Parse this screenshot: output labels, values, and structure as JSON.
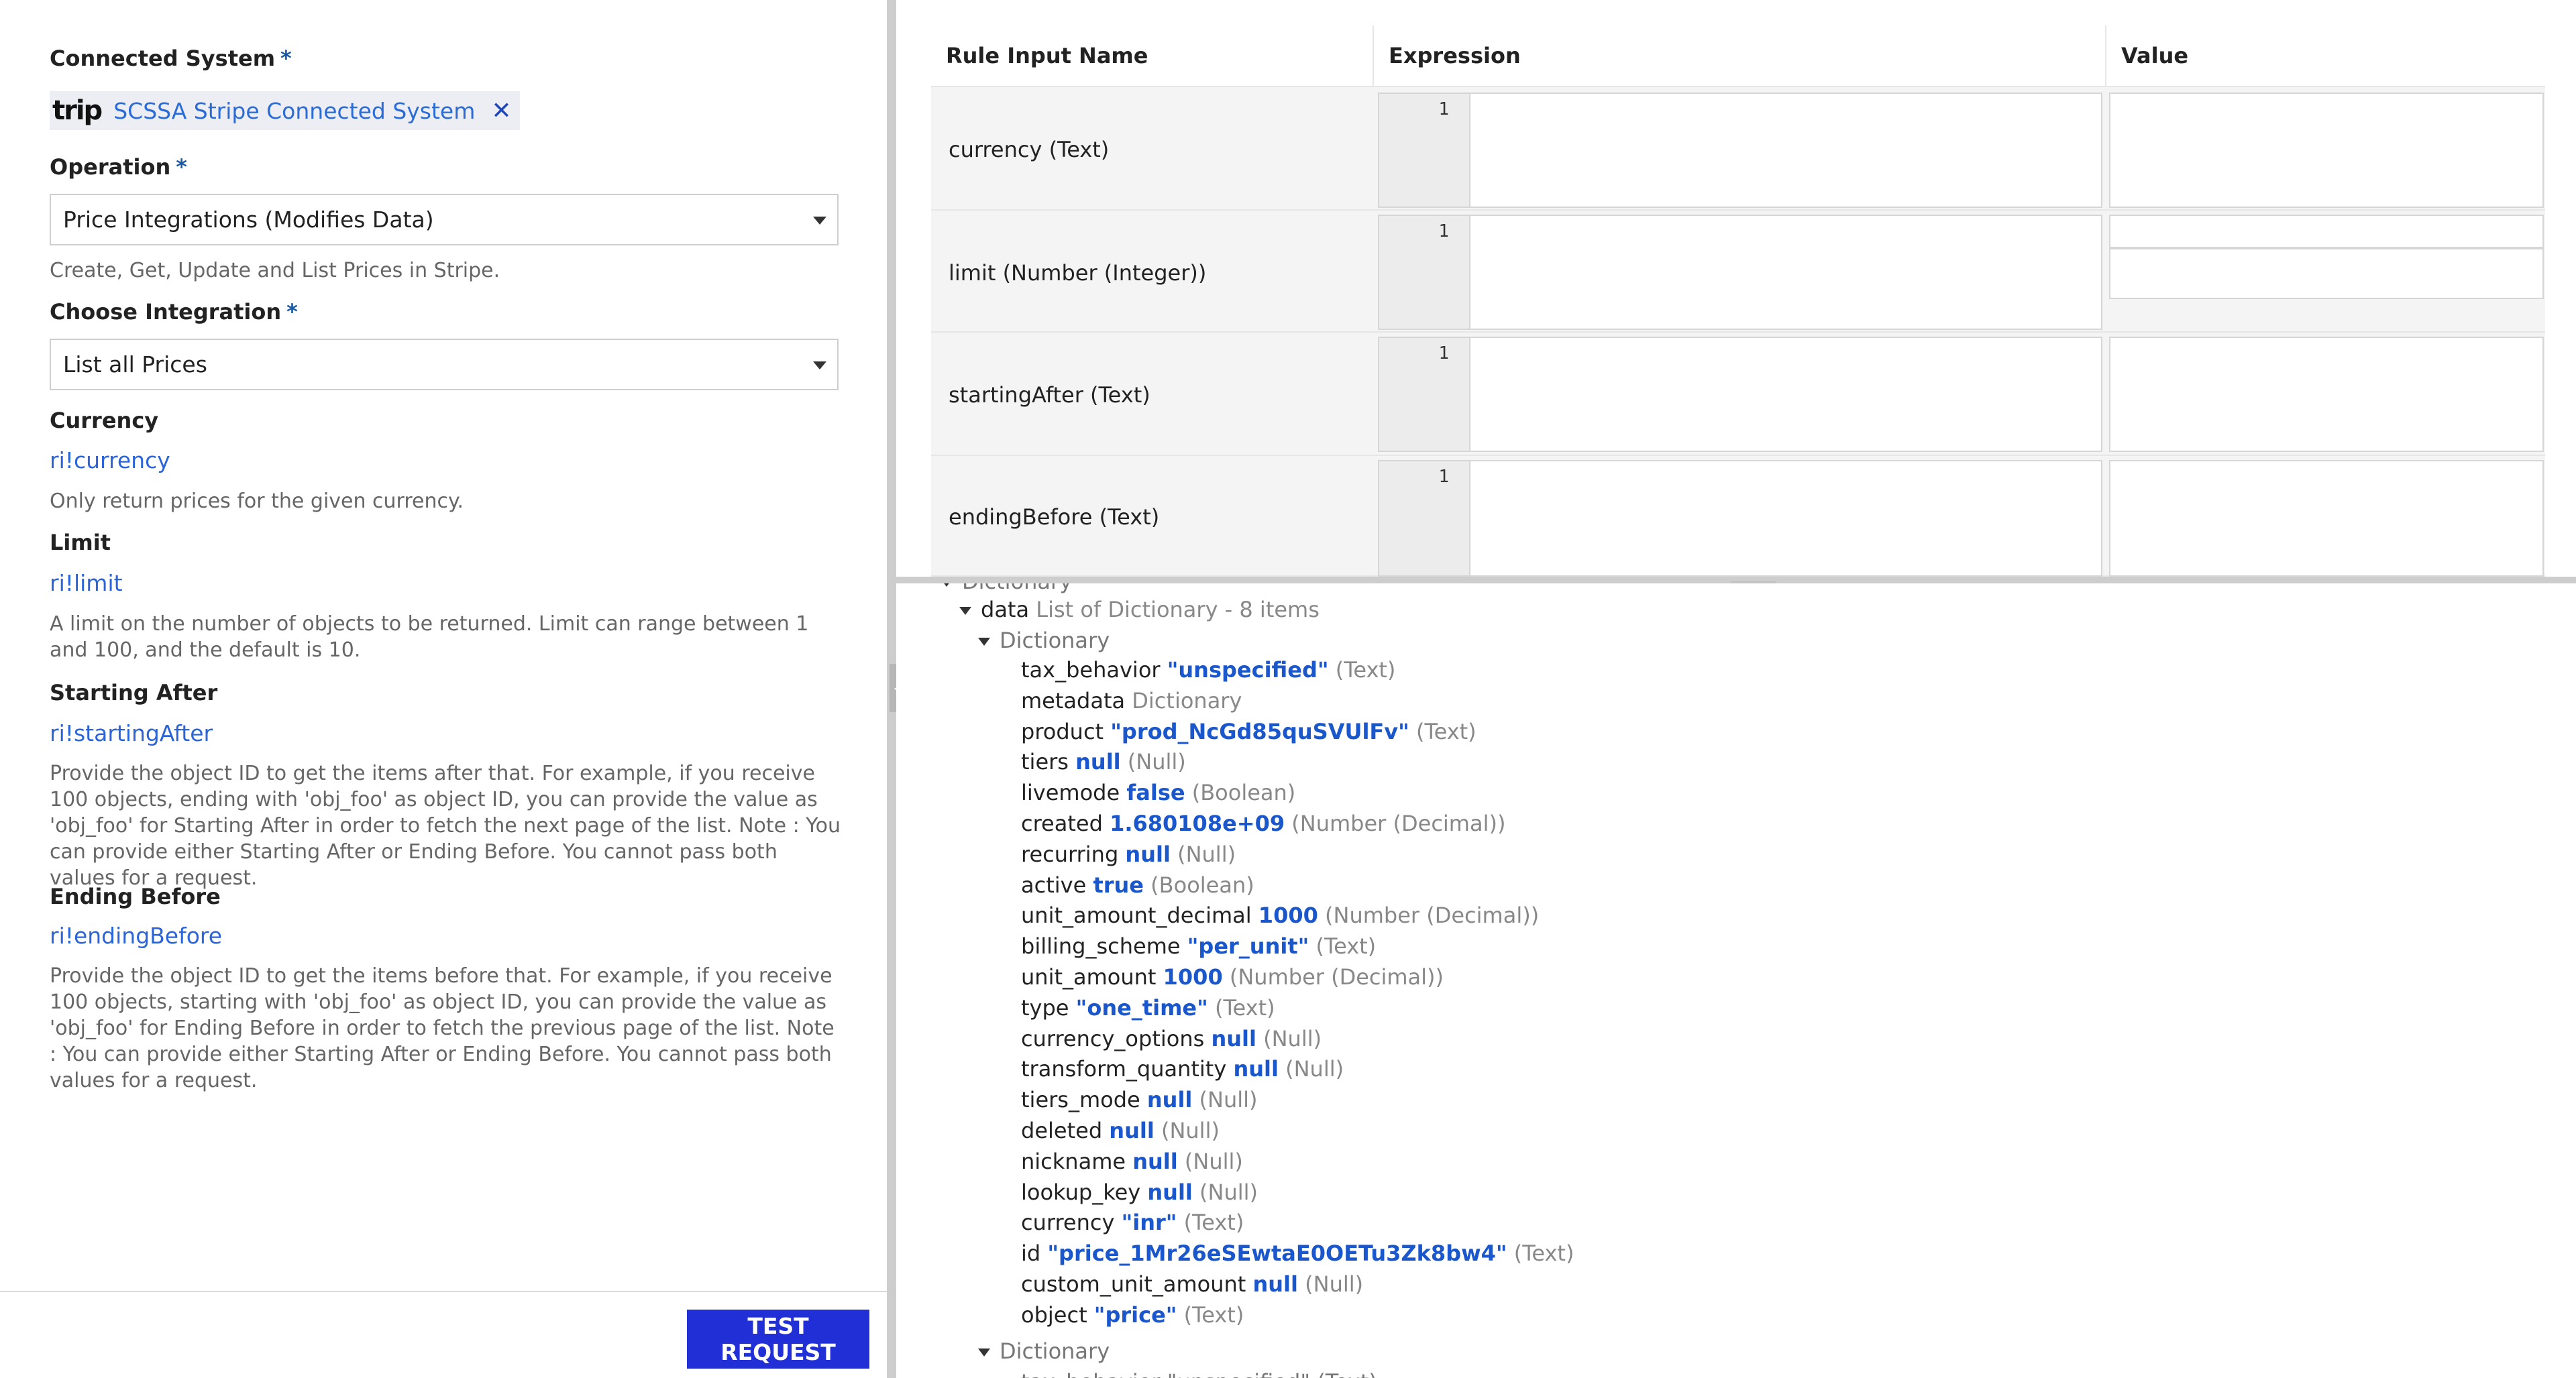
{
  "left": {
    "connected_system_label": "Connected System",
    "required_mark": "*",
    "chip_logo": "trip",
    "chip_text": "SCSSA Stripe Connected System",
    "chip_remove": "✕",
    "operation_label": "Operation",
    "operation_value": "Price Integrations (Modifies Data)",
    "operation_help": "Create, Get, Update and List Prices in Stripe.",
    "integration_label": "Choose Integration",
    "integration_value": "List all Prices",
    "currency_label": "Currency",
    "currency_link": "ri!currency",
    "currency_help": "Only return prices for the given currency.",
    "limit_label": "Limit",
    "limit_link": "ri!limit",
    "limit_help": "A limit on the number of objects to be returned. Limit can range between 1 and 100, and the default is 10.",
    "starting_label": "Starting After",
    "starting_link": "ri!startingAfter",
    "starting_help": "Provide the object ID to get the items after that. For example, if you receive 100 objects, ending with 'obj_foo' as object ID, you can provide the value as 'obj_foo' for Starting After in order to fetch the next page of the list. Note : You can provide either Starting After or Ending Before. You cannot pass both values for a request.",
    "ending_label": "Ending Before",
    "ending_link": "ri!endingBefore",
    "ending_help": "Provide the object ID to get the items before that. For example, if you receive 100 objects, starting with 'obj_foo' as object ID, you can provide the value as 'obj_foo' for Ending Before in order to fetch the previous page of the list. Note : You can provide either Starting After or Ending Before. You cannot pass both values for a request.",
    "test_button": "TEST REQUEST"
  },
  "table": {
    "headers": [
      "Rule Input Name",
      "Expression",
      "Value"
    ],
    "rows": [
      {
        "name": "currency (Text)",
        "line": "1"
      },
      {
        "name": "limit (Number (Integer))",
        "line": "1"
      },
      {
        "name": "startingAfter (Text)",
        "line": "1"
      },
      {
        "name": "endingBefore (Text)",
        "line": "1"
      }
    ]
  },
  "tree": {
    "root": "Dictionary",
    "data_key": "data",
    "data_type": "List of Dictionary - 8 items",
    "dict_label": "Dictionary",
    "entries": [
      {
        "key": "tax_behavior",
        "value": "\"unspecified\"",
        "type": "(Text)"
      },
      {
        "key": "metadata",
        "value": "",
        "type": "Dictionary"
      },
      {
        "key": "product",
        "value": "\"prod_NcGd85quSVUlFv\"",
        "type": "(Text)"
      },
      {
        "key": "tiers",
        "value": "null",
        "type": "(Null)"
      },
      {
        "key": "livemode",
        "value": "false",
        "type": "(Boolean)"
      },
      {
        "key": "created",
        "value": "1.680108e+09",
        "type": "(Number (Decimal))"
      },
      {
        "key": "recurring",
        "value": "null",
        "type": "(Null)"
      },
      {
        "key": "active",
        "value": "true",
        "type": "(Boolean)"
      },
      {
        "key": "unit_amount_decimal",
        "value": "1000",
        "type": "(Number (Decimal))"
      },
      {
        "key": "billing_scheme",
        "value": "\"per_unit\"",
        "type": "(Text)"
      },
      {
        "key": "unit_amount",
        "value": "1000",
        "type": "(Number (Decimal))"
      },
      {
        "key": "type",
        "value": "\"one_time\"",
        "type": "(Text)"
      },
      {
        "key": "currency_options",
        "value": "null",
        "type": "(Null)"
      },
      {
        "key": "transform_quantity",
        "value": "null",
        "type": "(Null)"
      },
      {
        "key": "tiers_mode",
        "value": "null",
        "type": "(Null)"
      },
      {
        "key": "deleted",
        "value": "null",
        "type": "(Null)"
      },
      {
        "key": "nickname",
        "value": "null",
        "type": "(Null)"
      },
      {
        "key": "lookup_key",
        "value": "null",
        "type": "(Null)"
      },
      {
        "key": "currency",
        "value": "\"inr\"",
        "type": "(Text)"
      },
      {
        "key": "id",
        "value": "\"price_1Mr26eSEwtaE0OETu3Zk8bw4\"",
        "type": "(Text)"
      },
      {
        "key": "custom_unit_amount",
        "value": "null",
        "type": "(Null)"
      },
      {
        "key": "object",
        "value": "\"price\"",
        "type": "(Text)"
      }
    ],
    "next_dict_label": "Dictionary",
    "next_partial": "tax_behavior \"unspecified\" (Text)"
  }
}
